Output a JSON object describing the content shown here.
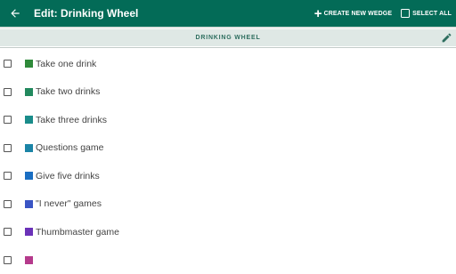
{
  "appbar": {
    "title": "Edit: Drinking Wheel",
    "create_label": "CREATE NEW WEDGE",
    "select_all_label": "SELECT ALL",
    "icons": {
      "back": "arrow-left-icon",
      "create": "plus-icon",
      "select_all": "checkbox-icon"
    }
  },
  "wheel": {
    "name": "DRINKING WHEEL",
    "edit_icon": "pencil-icon"
  },
  "wedges": [
    {
      "label": "Take one drink",
      "color": "#2f8a3a"
    },
    {
      "label": "Take two drinks",
      "color": "#22895e"
    },
    {
      "label": "Take three drinks",
      "color": "#1a8c8a"
    },
    {
      "label": "Questions game",
      "color": "#1b84a6"
    },
    {
      "label": "Give five drinks",
      "color": "#1a6ec2"
    },
    {
      "label": "\"I never\" games",
      "color": "#3a55c4"
    },
    {
      "label": "Thumbmaster game",
      "color": "#6b32b8"
    },
    {
      "label": "",
      "color": "#b53a8c"
    }
  ],
  "colors": {
    "primary": "#036b57",
    "header_bg": "#dfe8e5",
    "header_text": "#2e6e5f"
  }
}
